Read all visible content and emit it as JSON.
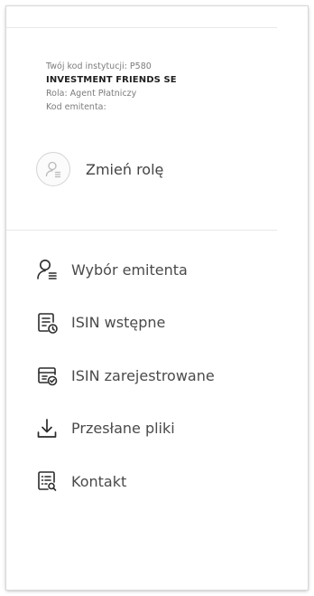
{
  "user_info": {
    "institution_code": "Twój kod instytucji: P580",
    "company_name": "INVESTMENT FRIENDS SE",
    "role": "Rola: Agent Płatniczy",
    "issuer_code": "Kod emitenta:"
  },
  "change_role": {
    "label": "Zmień rolę",
    "icon": "user-switch-icon"
  },
  "menu": {
    "items": [
      {
        "label": "Wybór emitenta",
        "icon": "user-list-icon"
      },
      {
        "label": "ISIN wstępne",
        "icon": "document-clock-icon"
      },
      {
        "label": "ISIN zarejestrowane",
        "icon": "document-check-icon"
      },
      {
        "label": "Przesłane pliki",
        "icon": "download-icon"
      },
      {
        "label": "Kontakt",
        "icon": "contact-list-icon"
      }
    ]
  },
  "colors": {
    "text": "#4a4a4a",
    "muted": "#7c7c7c",
    "icon": "#2b2b2b",
    "divider": "#e9e9e9"
  }
}
